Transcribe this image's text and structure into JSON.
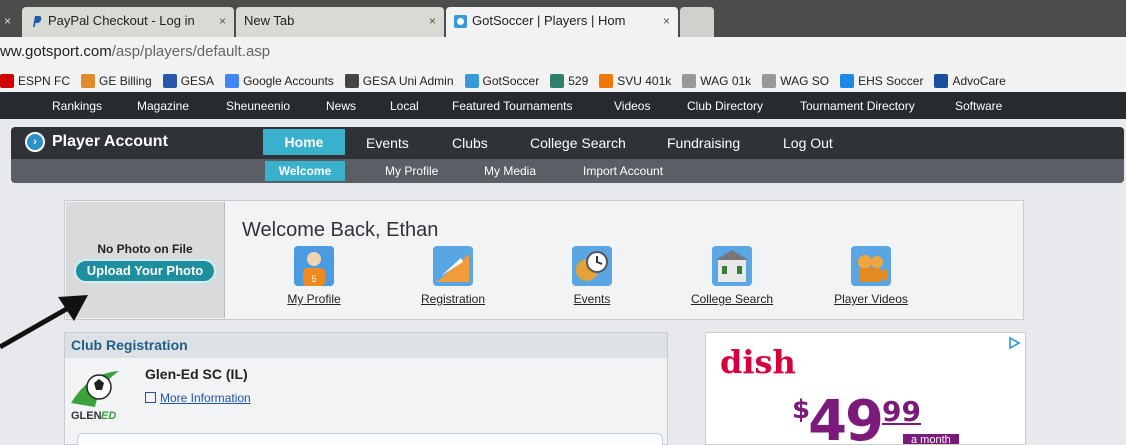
{
  "browser": {
    "tabs": [
      {
        "title": "PayPal Checkout - Log in",
        "close": "×"
      },
      {
        "title": "New Tab",
        "close": "×"
      },
      {
        "title": "GotSoccer | Players | Hom",
        "close": "×"
      }
    ],
    "url_host_prefix": "ww.gotsport.com",
    "url_path": "/asp/players/default.asp",
    "bookmarks": [
      {
        "label": "ESPN FC",
        "icon": "espn-icon",
        "color": "#d00000"
      },
      {
        "label": "GE Billing",
        "icon": "ge-icon",
        "color": "#e28b2d"
      },
      {
        "label": "GESA",
        "icon": "gesa-icon",
        "color": "#2a58a8"
      },
      {
        "label": "Google Accounts",
        "icon": "google-icon",
        "color": "#4285f4"
      },
      {
        "label": "GESA Uni Admin",
        "icon": "ball-icon",
        "color": "#444444"
      },
      {
        "label": "GotSoccer",
        "icon": "gotsoccer-icon",
        "color": "#3a9ad9"
      },
      {
        "label": "529",
        "icon": "529-icon",
        "color": "#2f7f6f"
      },
      {
        "label": "SVU 401k",
        "icon": "svu-icon",
        "color": "#f07800"
      },
      {
        "label": "WAG 01k",
        "icon": "page-icon",
        "color": "#999999"
      },
      {
        "label": "WAG SO",
        "icon": "page-icon",
        "color": "#999999"
      },
      {
        "label": "EHS Soccer",
        "icon": "ehs-icon",
        "color": "#1e88e5"
      },
      {
        "label": "AdvoCare",
        "icon": "advocare-icon",
        "color": "#1b4fa0"
      }
    ]
  },
  "site": {
    "topnav": [
      "Rankings",
      "Magazine",
      "Sheuneenio",
      "News",
      "Local",
      "Featured Tournaments",
      "Videos",
      "Club Directory",
      "Tournament Directory",
      "Software"
    ],
    "player_account": "Player Account",
    "nav1": [
      "Home",
      "Events",
      "Clubs",
      "College Search",
      "Fundraising",
      "Log Out"
    ],
    "nav2": [
      "Welcome",
      "My Profile",
      "My Media",
      "Import Account"
    ],
    "welcome": {
      "no_photo": "No Photo on File",
      "upload": "Upload Your Photo",
      "title": "Welcome Back, Ethan",
      "links": [
        "My Profile",
        "Registration",
        "Events",
        "College Search",
        "Player Videos"
      ]
    },
    "club": {
      "header": "Club Registration",
      "name": "Glen-Ed SC (IL)",
      "more": "More Information",
      "logo_text": "GLENED"
    },
    "ad": {
      "brand": "dish",
      "dollar": "$",
      "price_whole": "49",
      "price_cents": "99",
      "per": "a month"
    }
  }
}
